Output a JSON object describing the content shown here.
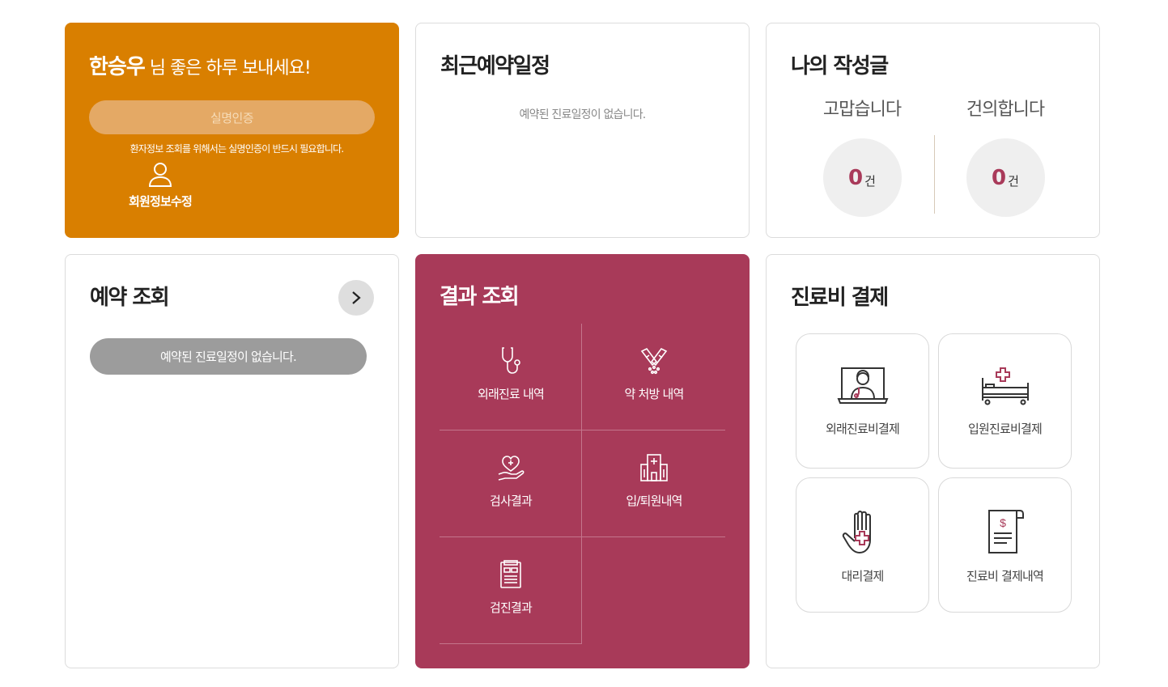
{
  "welcome": {
    "user_name": "한승우",
    "greeting_suffix": "님 좋은 하루 보내세요!",
    "verify_button": "실명인증",
    "verify_notice": "환자정보 조회를 위해서는 실명인증이 반드시 필요합니다.",
    "member_edit_label": "회원정보수정",
    "member_icon": "user-icon"
  },
  "recent_schedule": {
    "title": "최근예약일정",
    "empty_message": "예약된 진료일정이 없습니다."
  },
  "my_posts": {
    "title": "나의 작성글",
    "thanks": {
      "label": "고맙습니다",
      "count": "0",
      "unit": "건"
    },
    "suggestions": {
      "label": "건의합니다",
      "count": "0",
      "unit": "건"
    }
  },
  "reservation_lookup": {
    "title": "예약 조회",
    "more_icon": "chevron-right-icon",
    "empty_message": "예약된 진료일정이 없습니다."
  },
  "results_lookup": {
    "title": "결과 조회",
    "items": [
      {
        "label": "외래진료 내역",
        "icon": "stethoscope-icon"
      },
      {
        "label": "약 처방 내역",
        "icon": "pills-icon"
      },
      {
        "label": "검사결과",
        "icon": "heart-hand-icon"
      },
      {
        "label": "입/퇴원내역",
        "icon": "hospital-icon"
      },
      {
        "label": "검진결과",
        "icon": "clipboard-icon"
      }
    ]
  },
  "payment": {
    "title": "진료비 결제",
    "items": [
      {
        "label": "외래진료비결제",
        "icon": "doctor-monitor-icon"
      },
      {
        "label": "입원진료비결제",
        "icon": "hospital-bed-icon"
      },
      {
        "label": "대리결제",
        "icon": "hand-cross-icon"
      },
      {
        "label": "진료비 결제내역",
        "icon": "receipt-icon"
      }
    ]
  },
  "colors": {
    "orange": "#d97f00",
    "berry": "#a83a59",
    "accent_num": "#a93a5a"
  }
}
